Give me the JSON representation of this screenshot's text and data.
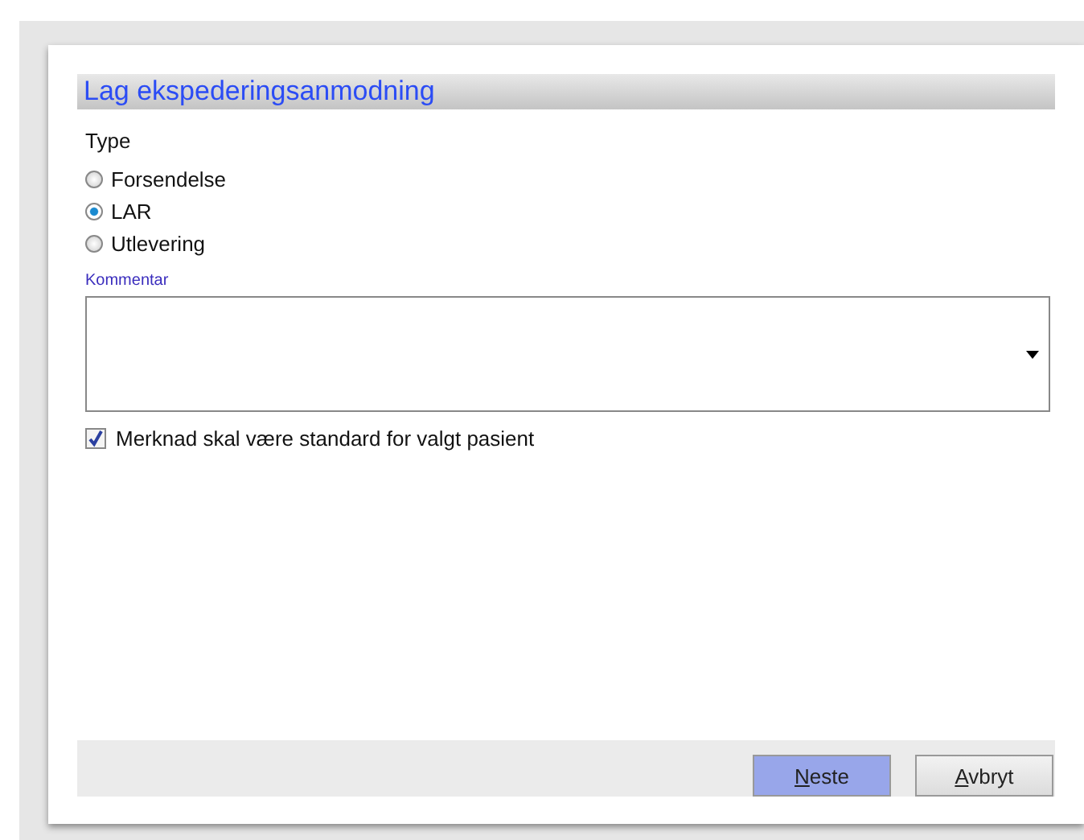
{
  "dialog": {
    "title": "Lag ekspederingsanmodning"
  },
  "type_group": {
    "label": "Type",
    "options": [
      {
        "label": "Forsendelse",
        "selected": false
      },
      {
        "label": "LAR",
        "selected": true
      },
      {
        "label": "Utlevering",
        "selected": false
      }
    ]
  },
  "comment": {
    "label": "Kommentar"
  },
  "default_checkbox": {
    "label": "Merknad skal være standard for valgt pasient",
    "checked": true
  },
  "buttons": [
    {
      "label": "Neste",
      "primary": true
    },
    {
      "label": "Avbryt",
      "primary": false
    }
  ]
}
